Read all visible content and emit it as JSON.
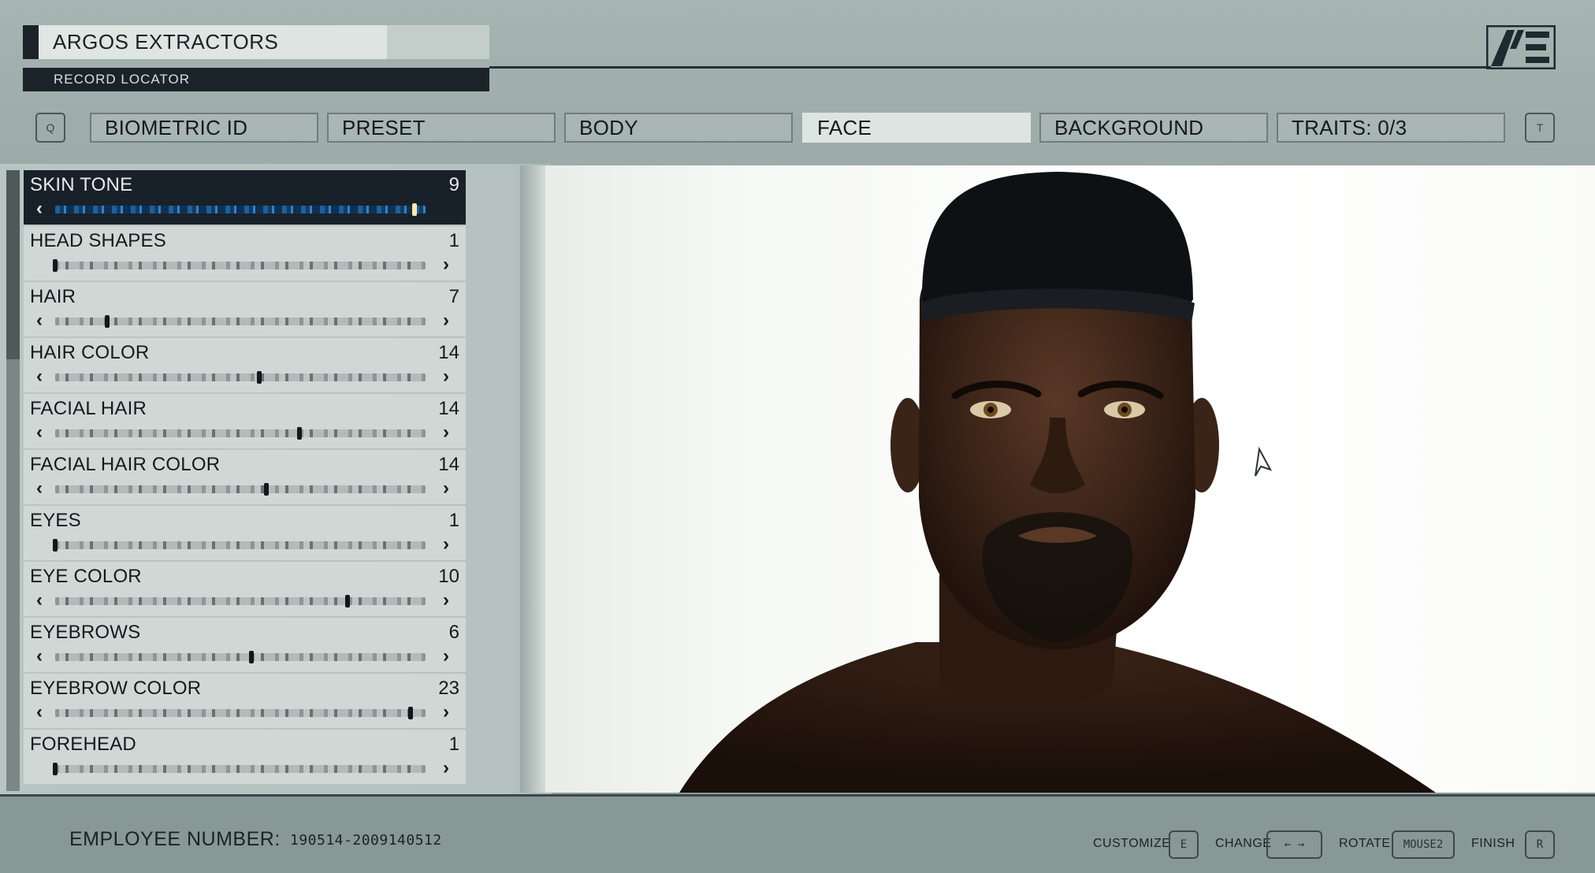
{
  "header": {
    "company": "ARGOS EXTRACTORS",
    "record_locator": "RECORD LOCATOR",
    "prev_key": "Q",
    "next_key": "T",
    "tabs": [
      {
        "label": "BIOMETRIC ID",
        "active": false
      },
      {
        "label": "PRESET",
        "active": false
      },
      {
        "label": "BODY",
        "active": false
      },
      {
        "label": "FACE",
        "active": true
      },
      {
        "label": "BACKGROUND",
        "active": false
      },
      {
        "label": "TRAITS: 0/3",
        "active": false
      }
    ]
  },
  "face_options": [
    {
      "label": "SKIN TONE",
      "value": "9",
      "position": 0.97,
      "selected": true
    },
    {
      "label": "HEAD SHAPES",
      "value": "1",
      "position": 0.0,
      "selected": false
    },
    {
      "label": "HAIR",
      "value": "7",
      "position": 0.14,
      "selected": false
    },
    {
      "label": "HAIR COLOR",
      "value": "14",
      "position": 0.55,
      "selected": false
    },
    {
      "label": "FACIAL HAIR",
      "value": "14",
      "position": 0.66,
      "selected": false
    },
    {
      "label": "FACIAL HAIR COLOR",
      "value": "14",
      "position": 0.57,
      "selected": false
    },
    {
      "label": "EYES",
      "value": "1",
      "position": 0.0,
      "selected": false
    },
    {
      "label": "EYE COLOR",
      "value": "10",
      "position": 0.79,
      "selected": false
    },
    {
      "label": "EYEBROWS",
      "value": "6",
      "position": 0.53,
      "selected": false
    },
    {
      "label": "EYEBROW COLOR",
      "value": "23",
      "position": 0.96,
      "selected": false
    },
    {
      "label": "FOREHEAD",
      "value": "1",
      "position": 0.0,
      "selected": false
    }
  ],
  "footer": {
    "employee_label": "EMPLOYEE NUMBER:",
    "employee_number": "190514-2009140512",
    "controls": [
      {
        "label": "CUSTOMIZE",
        "key": "E"
      },
      {
        "label": "CHANGE",
        "key": "← →"
      },
      {
        "label": "ROTATE",
        "key": "MOUSE2"
      },
      {
        "label": "FINISH",
        "key": "R"
      }
    ]
  },
  "colors": {
    "selected_row": "#18212a",
    "skin_track": "#1f5f9a",
    "background": "#a7b5b2",
    "skin": "#3b2418"
  },
  "icons": {
    "logo": "constellation-logo-icon",
    "prev": "chevron-left-icon",
    "next": "chevron-right-icon",
    "cursor": "cursor-arrow-icon"
  }
}
